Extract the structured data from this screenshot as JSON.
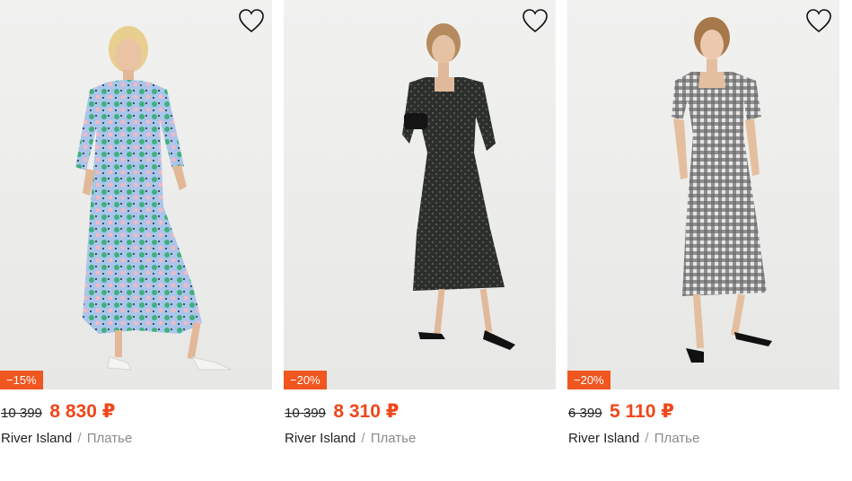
{
  "products": [
    {
      "discount": "−15%",
      "old_price": "10 399",
      "new_price": "8 830 ₽",
      "brand": "River Island",
      "separator": "/",
      "category": "Платье",
      "dress_colors": [
        "#5cc49a",
        "#a9c6ea",
        "#f2b8c6"
      ]
    },
    {
      "discount": "−20%",
      "old_price": "10 399",
      "new_price": "8 310 ₽",
      "brand": "River Island",
      "separator": "/",
      "category": "Платье",
      "dress_colors": [
        "#2c2f2c",
        "#3b3e3a"
      ]
    },
    {
      "discount": "−20%",
      "old_price": "6 399",
      "new_price": "5 110 ₽",
      "brand": "River Island",
      "separator": "/",
      "category": "Платье",
      "dress_colors": [
        "#3d3d3d",
        "#e6e6e6"
      ]
    }
  ],
  "icons": {
    "favorite": "heart-outline-icon"
  },
  "colors": {
    "badge": "#f0561f",
    "new_price": "#f0461a"
  }
}
